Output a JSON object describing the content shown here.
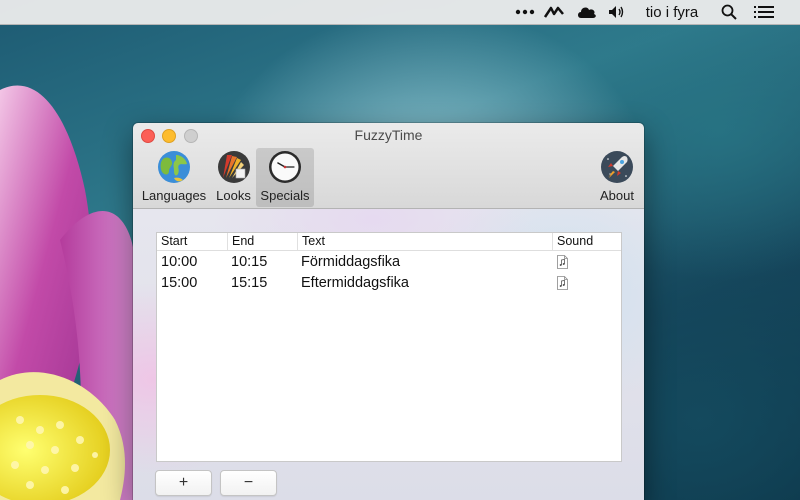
{
  "menubar": {
    "clock_text": "tio i fyra",
    "icons": [
      "more-icon",
      "activity-icon",
      "cloud-icon",
      "volume-icon",
      "search-icon",
      "list-icon"
    ]
  },
  "window": {
    "title": "FuzzyTime",
    "toolbar": {
      "items": [
        {
          "label": "Languages",
          "icon": "globe-icon"
        },
        {
          "label": "Looks",
          "icon": "palette-icon"
        },
        {
          "label": "Specials",
          "icon": "clock-icon",
          "selected": true
        },
        {
          "label": "About",
          "icon": "rocket-icon"
        }
      ]
    },
    "table": {
      "headers": [
        "Start",
        "End",
        "Text",
        "Sound"
      ],
      "rows": [
        {
          "start": "10:00",
          "end": "10:15",
          "text": "Förmiddagsfika"
        },
        {
          "start": "15:00",
          "end": "15:15",
          "text": "Eftermiddagsfika"
        }
      ]
    },
    "buttons": {
      "add_label": "+",
      "remove_label": "−"
    }
  },
  "colors": {
    "close": "#fc5f57",
    "minimize": "#fdbc2e",
    "zoom": "#cfcfcf"
  }
}
